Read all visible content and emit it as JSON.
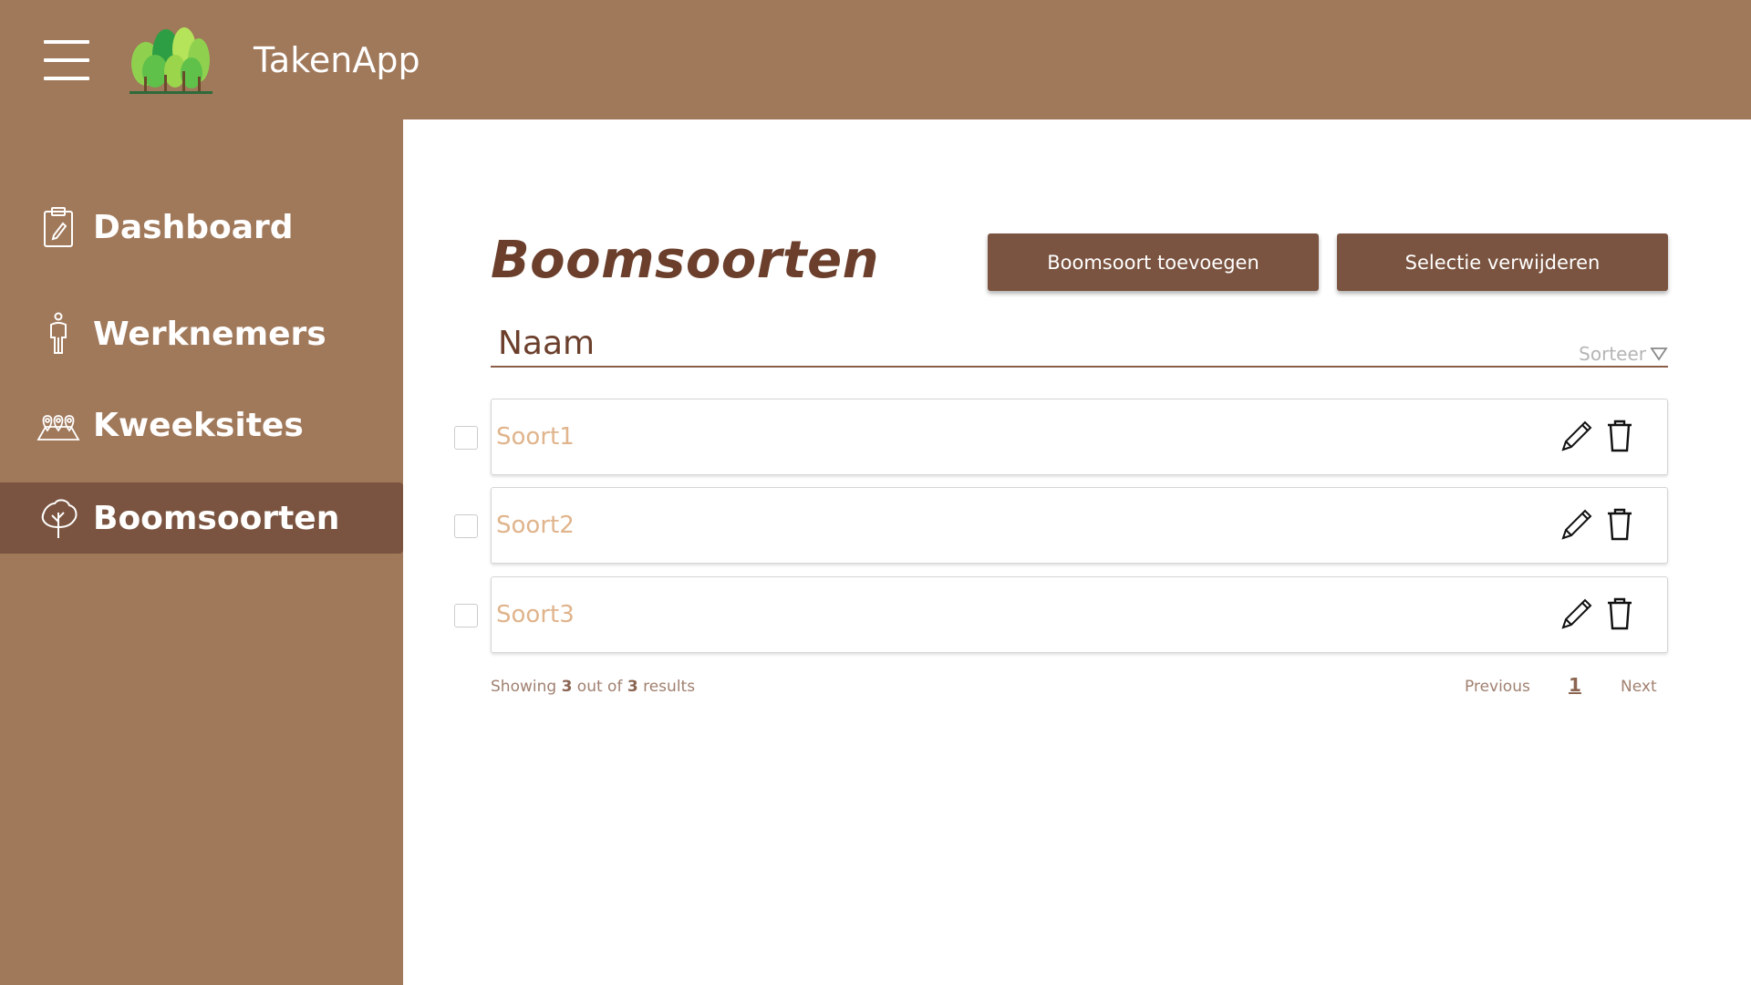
{
  "header": {
    "app_title": "TakenApp",
    "menu_icon": "hamburger-menu-icon",
    "logo_icon": "trees-logo"
  },
  "sidebar": {
    "items": [
      {
        "label": "Dashboard",
        "icon": "clipboard-icon",
        "active": false
      },
      {
        "label": "Werknemers",
        "icon": "person-icon",
        "active": false
      },
      {
        "label": "Kweeksites",
        "icon": "map-pins-icon",
        "active": false
      },
      {
        "label": "Boomsoorten",
        "icon": "tree-icon",
        "active": true
      }
    ]
  },
  "main": {
    "title": "Boomsoorten",
    "add_button": "Boomsoort  toevoegen",
    "delete_button": "Selectie verwijderen",
    "column_name": "Naam",
    "sort_label": "Sorteer",
    "rows": [
      {
        "name": "Soort1"
      },
      {
        "name": "Soort2"
      },
      {
        "name": "Soort3"
      }
    ],
    "footer": {
      "showing_prefix": "Showing ",
      "shown_count": "3",
      "middle": " out of ",
      "total_count": "3",
      "suffix": " results",
      "previous": "Previous",
      "page": "1",
      "next": "Next"
    }
  },
  "colors": {
    "brand_brown": "#a0785a",
    "dark_brown": "#7a5440",
    "title_brown": "#6b3f2c",
    "row_text": "#e0b48c"
  }
}
